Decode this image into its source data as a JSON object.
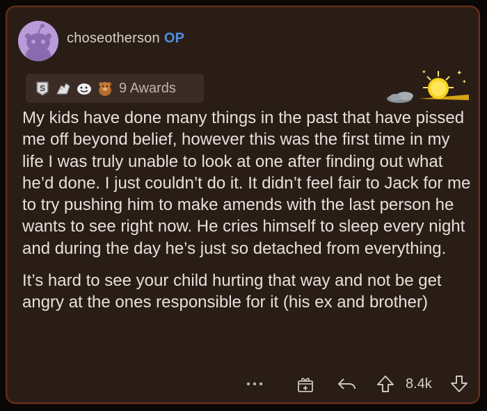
{
  "comment": {
    "username": "choseotherson",
    "op_badge": "OP",
    "awards_label": "9 Awards",
    "award_icons": [
      "silver-award-icon",
      "hands-award-icon",
      "smile-award-icon",
      "bear-award-icon"
    ],
    "flair_icon": "sun-cloud-flair-icon",
    "paragraphs": [
      "My kids have done many things in the past that have pissed me off beyond belief, however this was the first time in my life I was truly unable to look at one after finding out what he’d done. I just couldn’t do it. It didn’t feel fair to Jack for me to try pushing him to make amends with the last person he wants to see right now. He cries himself to sleep every night and during the day he’s just so detached from everything.",
      "It’s hard to see your child hurting that way and not be get angry at the ones responsible for it (his ex and brother)"
    ],
    "actions": {
      "more": "•••",
      "vote_count": "8.4k"
    }
  },
  "colors": {
    "background": "#0a0705",
    "card": "#2a1d16",
    "card_border": "#6b2d1b",
    "text": "#e6e0dc",
    "username": "#d6cfca",
    "op": "#4d8fe0"
  }
}
